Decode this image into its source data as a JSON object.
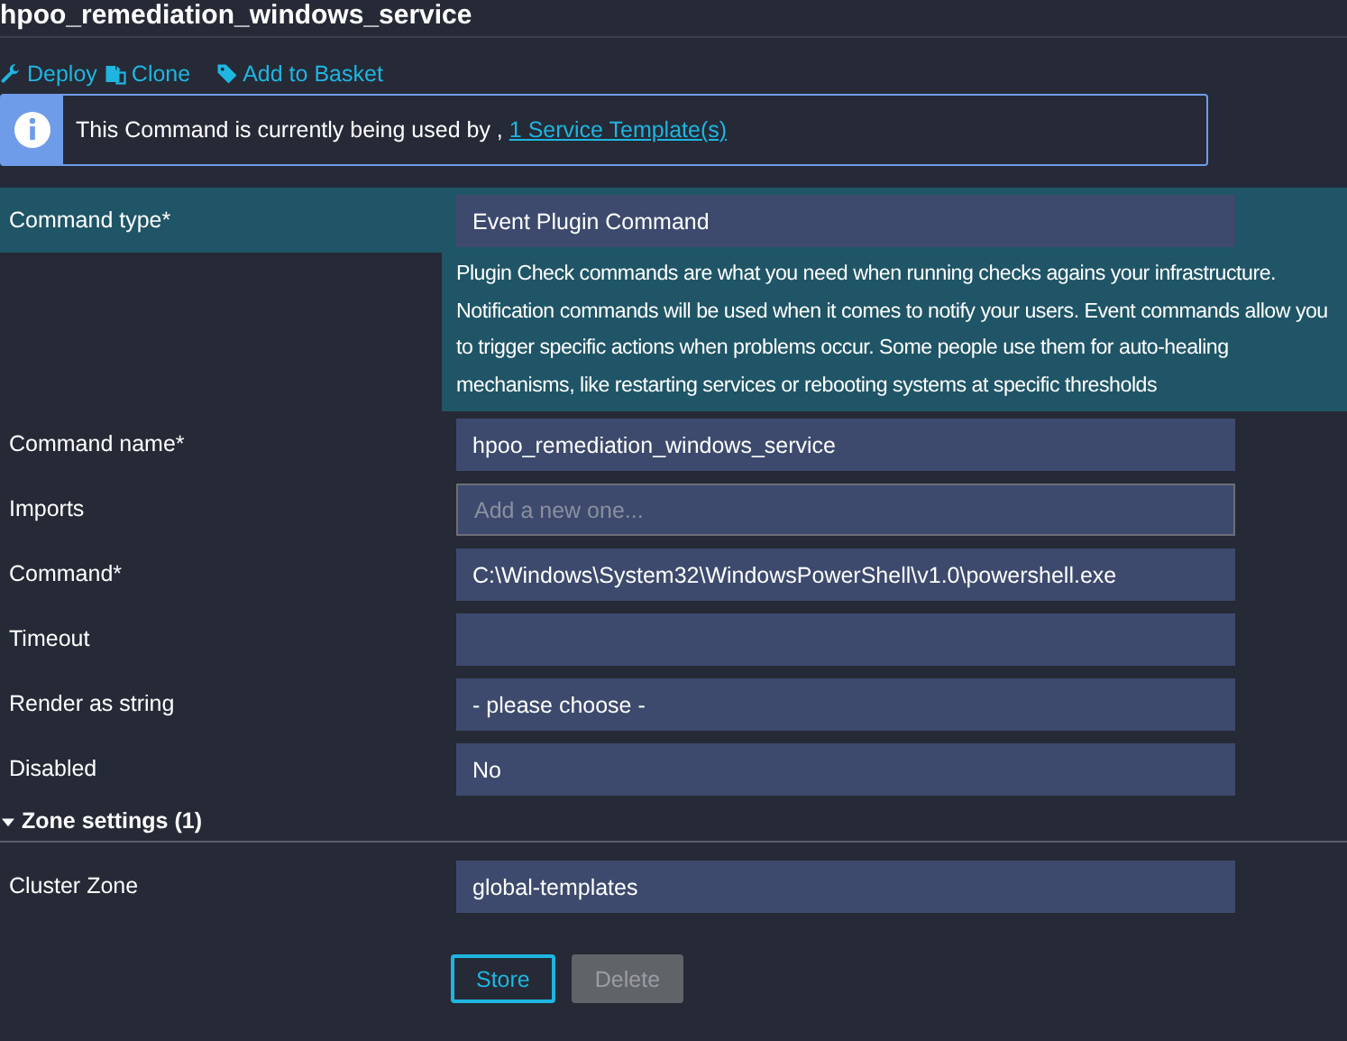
{
  "title": "hpoo_remediation_windows_service",
  "actions": [
    {
      "label": "Deploy",
      "kind": "wrench"
    },
    {
      "label": "Clone",
      "kind": "copy"
    },
    {
      "label": "Add to Basket",
      "kind": "tag"
    }
  ],
  "info": {
    "text": "This Command is currently being used by , ",
    "link": "1 Service Template(s)"
  },
  "fields": [
    {
      "label": "Command type*",
      "kind": "select",
      "value": "Event Plugin Command",
      "highlighted": true,
      "description": "Plugin Check commands are what you need when running checks agains your infrastructure. Notification commands will be used when it comes to notify your users. Event commands allow you to trigger specific actions when problems occur. Some people use them for auto-healing mechanisms, like restarting services or rebooting systems at specific thresholds"
    },
    {
      "label": "Command name*",
      "kind": "text",
      "value": "hpoo_remediation_windows_service",
      "highlighted": false
    },
    {
      "label": "Imports",
      "kind": "tags",
      "placeholder": "Add a new one...",
      "highlighted": false
    },
    {
      "label": "Command*",
      "kind": "text",
      "value": "C:\\Windows\\System32\\WindowsPowerShell\\v1.0\\powershell.exe",
      "highlighted": false
    },
    {
      "label": "Timeout",
      "kind": "text",
      "highlighted": false
    },
    {
      "label": "Render as string",
      "kind": "select",
      "value": "- please choose -",
      "highlighted": false
    },
    {
      "label": "Disabled",
      "kind": "select",
      "value": "No",
      "highlighted": false
    }
  ],
  "section": {
    "label": "Zone settings (1)",
    "expanded": true,
    "fields": [
      {
        "label": "Cluster Zone",
        "kind": "select",
        "value": "global-templates",
        "highlighted": false
      }
    ]
  },
  "buttons": [
    {
      "label": "Store",
      "disabled": false,
      "focused": true
    },
    {
      "label": "Delete",
      "disabled": true,
      "focused": false
    }
  ]
}
